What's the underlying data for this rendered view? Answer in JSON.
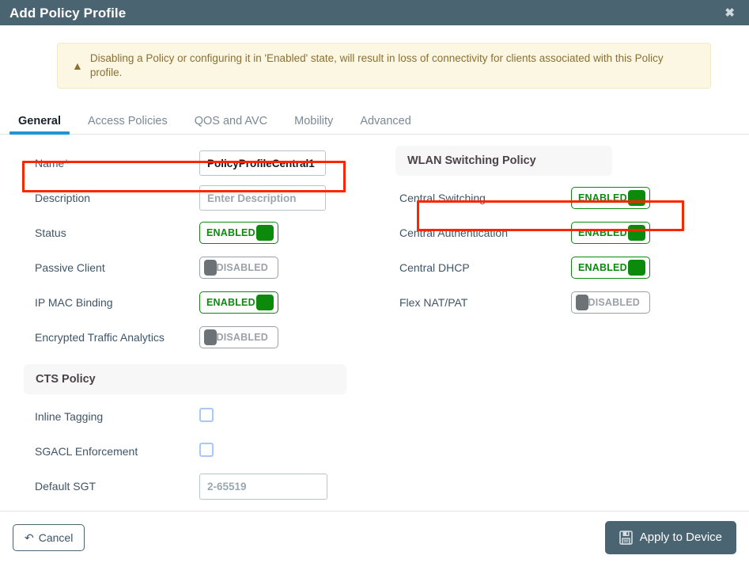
{
  "titlebar": {
    "title": "Add Policy Profile",
    "close_label": "✖"
  },
  "warning": {
    "icon": "warning-triangle-icon",
    "text": "Disabling a Policy or configuring it in 'Enabled' state, will result in loss of connectivity for clients associated with this Policy profile."
  },
  "tabs": [
    {
      "label": "General",
      "active": true
    },
    {
      "label": "Access Policies",
      "active": false
    },
    {
      "label": "QOS and AVC",
      "active": false
    },
    {
      "label": "Mobility",
      "active": false
    },
    {
      "label": "Advanced",
      "active": false
    }
  ],
  "left": {
    "fields": [
      {
        "label": "Name*",
        "value": "PolicyProfileCentral1"
      },
      {
        "label": "Description",
        "placeholder": "Enter Description"
      },
      {
        "label": "Status",
        "state": "ENABLED"
      },
      {
        "label": "Passive Client",
        "state": "DISABLED"
      },
      {
        "label": "IP MAC Binding",
        "state": "ENABLED"
      },
      {
        "label": "Encrypted Traffic Analytics",
        "state": "DISABLED"
      }
    ],
    "cts_section": {
      "title": "CTS Policy",
      "inline_tagging_label": "Inline Tagging",
      "sgacl_label": "SGACL Enforcement",
      "default_sgt_label": "Default SGT",
      "default_sgt_placeholder": "2-65519"
    }
  },
  "right": {
    "section_title": "WLAN Switching Policy",
    "fields": [
      {
        "label": "Central Switching",
        "state": "ENABLED"
      },
      {
        "label": "Central Authentication",
        "state": "ENABLED"
      },
      {
        "label": "Central DHCP",
        "state": "ENABLED"
      },
      {
        "label": "Flex NAT/PAT",
        "state": "DISABLED"
      }
    ]
  },
  "footer": {
    "cancel_label": "Cancel",
    "apply_label": "Apply to Device"
  },
  "colors": {
    "titlebar_bg": "#4a6472",
    "warning_bg": "#fcf7e3",
    "warning_text": "#8a7033",
    "tab_active_underline": "#2196d6",
    "toggle_on": "#0b8a0b",
    "toggle_off": "#6c7276",
    "highlight_red": "#fa2600",
    "checkbox_border": "#a8c8f5"
  }
}
